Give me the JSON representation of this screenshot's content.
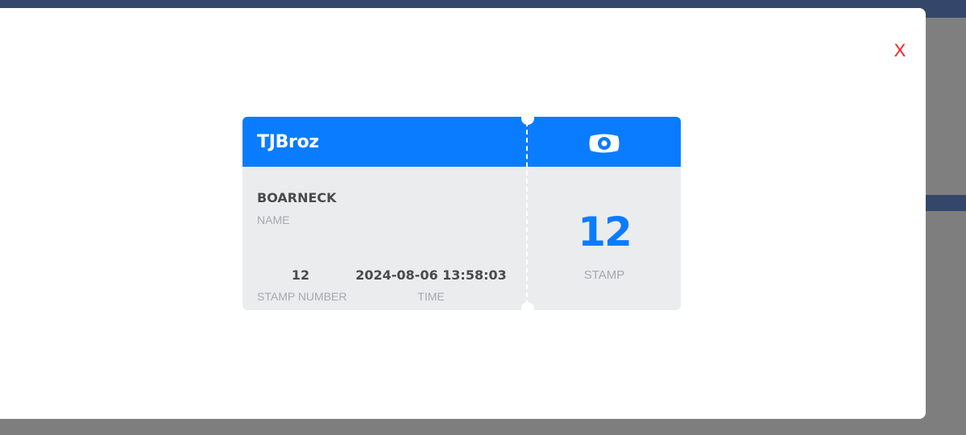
{
  "modal": {
    "close_label": "X"
  },
  "ticket": {
    "brand": "TJBroz",
    "name_value": "BOARNECK",
    "name_label": "NAME",
    "stamp_number_value": "12",
    "stamp_number_label": "STAMP NUMBER",
    "time_value": "2024-08-06 13:58:03",
    "time_label": "TIME",
    "stamp_value": "12",
    "stamp_label": "STAMP",
    "header_icon": "eye-icon"
  },
  "colors": {
    "accent": "#0a7cff",
    "close": "#ff1a1a",
    "card_body": "#ebecee",
    "backdrop": "#7e7e7e",
    "app_bar": "#34476a"
  }
}
